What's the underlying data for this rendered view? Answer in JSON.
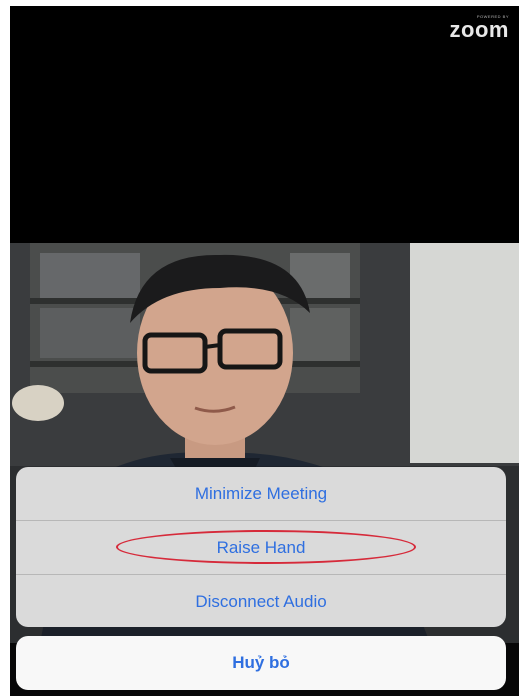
{
  "app": {
    "powered_by": "POWERED BY",
    "brand": "zoom"
  },
  "action_sheet": {
    "items": [
      {
        "label": "Minimize Meeting"
      },
      {
        "label": "Raise Hand",
        "highlighted": true
      },
      {
        "label": "Disconnect Audio"
      }
    ],
    "cancel_label": "Huỷ bỏ"
  },
  "colors": {
    "action_text": "#2f6fe0",
    "highlight": "#d62a3a",
    "screen_background": "#000000"
  }
}
